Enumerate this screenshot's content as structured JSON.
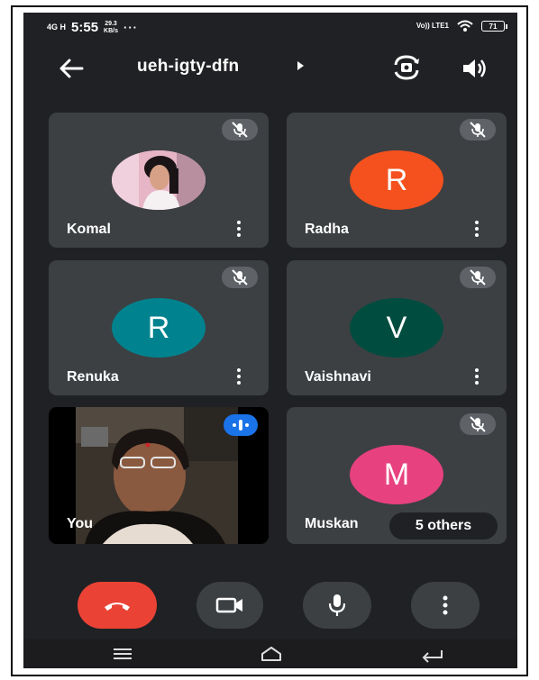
{
  "status_bar": {
    "network": "4G H",
    "time": "5:55",
    "speed_value": "29.3",
    "speed_unit": "KB/s",
    "more": "···",
    "volte": "Vo)) LTE1",
    "battery": "71"
  },
  "header": {
    "meeting_code": "ueh-igty-dfn"
  },
  "participants": [
    {
      "name": "Komal",
      "initial": "",
      "color": "",
      "muted": true
    },
    {
      "name": "Radha",
      "initial": "R",
      "color": "#f4511e",
      "muted": true
    },
    {
      "name": "Renuka",
      "initial": "R",
      "color": "#00838f",
      "muted": true
    },
    {
      "name": "Vaishnavi",
      "initial": "V",
      "color": "#004d40",
      "muted": true
    },
    {
      "name": "You",
      "initial": "",
      "color": "",
      "muted": false
    },
    {
      "name": "Muskan",
      "initial": "M",
      "color": "#e8417f",
      "muted": true
    }
  ],
  "others_chip": "5 others",
  "colors": {
    "background": "#202124",
    "tile": "#3c4043",
    "end_call": "#ea4335",
    "speaking": "#1a73e8"
  },
  "icons": [
    "back-arrow-icon",
    "camera-switch-icon",
    "speaker-icon",
    "mic-off-icon",
    "more-vert-icon",
    "call-end-icon",
    "videocam-icon",
    "mic-icon",
    "menu-icon",
    "home-icon",
    "back-nav-icon"
  ]
}
